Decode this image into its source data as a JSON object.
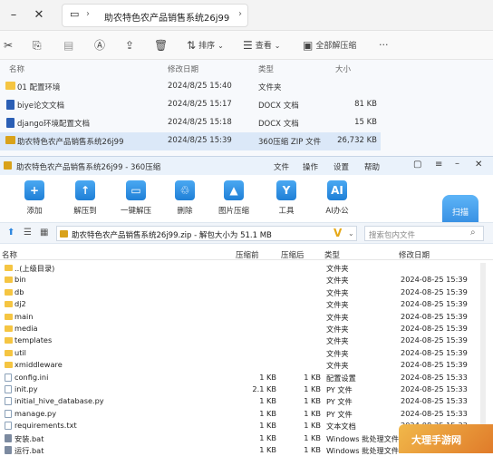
{
  "explorer": {
    "path": "助农特色农产品销售系统26j99",
    "toolbar": {
      "sort": "排序",
      "view": "查看",
      "extract_all": "全部解压缩",
      "more": "···"
    },
    "columns": {
      "name": "名称",
      "date": "修改日期",
      "type": "类型",
      "size": "大小"
    },
    "rows": [
      {
        "name": "01 配置环境",
        "date": "2024/8/25 15:40",
        "type": "文件夹",
        "size": "",
        "icon": "folder"
      },
      {
        "name": "biye论文文档",
        "date": "2024/8/25 15:17",
        "type": "DOCX 文档",
        "size": "81 KB",
        "icon": "docx"
      },
      {
        "name": "django环境配置文档",
        "date": "2024/8/25 15:18",
        "type": "DOCX 文档",
        "size": "15 KB",
        "icon": "docx"
      },
      {
        "name": "助农特色农产品销售系统26j99",
        "date": "2024/8/25 15:39",
        "type": "360压缩 ZIP 文件",
        "size": "26,732 KB",
        "icon": "zip"
      }
    ]
  },
  "zipwin": {
    "title": "助农特色农产品销售系统26j99 - 360压缩",
    "menu": [
      "文件",
      "操作",
      "设置",
      "帮助"
    ],
    "tools": [
      {
        "label": "添加",
        "glyph": "+"
      },
      {
        "label": "解压到",
        "glyph": "↑"
      },
      {
        "label": "一键解压",
        "glyph": "▭"
      },
      {
        "label": "删除",
        "glyph": "♲"
      },
      {
        "label": "图片压缩",
        "glyph": "▲"
      },
      {
        "label": "工具",
        "glyph": "Y"
      },
      {
        "label": "AI办公",
        "glyph": "AI"
      }
    ],
    "scan_label": "扫描",
    "path": "助农特色农产品销售系统26j99.zip - 解包大小为 51.1 MB",
    "search_placeholder": "搜索包内文件",
    "columns": {
      "name": "名称",
      "packed": "压缩前",
      "size": "压缩后",
      "type": "类型",
      "date": "修改日期"
    },
    "rows": [
      {
        "name": "..(上级目录)",
        "packed": "",
        "size": "",
        "type": "文件夹",
        "date": "",
        "icon": "folder"
      },
      {
        "name": "bin",
        "packed": "",
        "size": "",
        "type": "文件夹",
        "date": "2024-08-25 15:39",
        "icon": "folder"
      },
      {
        "name": "db",
        "packed": "",
        "size": "",
        "type": "文件夹",
        "date": "2024-08-25 15:39",
        "icon": "folder"
      },
      {
        "name": "dj2",
        "packed": "",
        "size": "",
        "type": "文件夹",
        "date": "2024-08-25 15:39",
        "icon": "folder"
      },
      {
        "name": "main",
        "packed": "",
        "size": "",
        "type": "文件夹",
        "date": "2024-08-25 15:39",
        "icon": "folder"
      },
      {
        "name": "media",
        "packed": "",
        "size": "",
        "type": "文件夹",
        "date": "2024-08-25 15:39",
        "icon": "folder"
      },
      {
        "name": "templates",
        "packed": "",
        "size": "",
        "type": "文件夹",
        "date": "2024-08-25 15:39",
        "icon": "folder"
      },
      {
        "name": "util",
        "packed": "",
        "size": "",
        "type": "文件夹",
        "date": "2024-08-25 15:39",
        "icon": "folder"
      },
      {
        "name": "xmiddleware",
        "packed": "",
        "size": "",
        "type": "文件夹",
        "date": "2024-08-25 15:39",
        "icon": "folder"
      },
      {
        "name": "config.ini",
        "packed": "1 KB",
        "size": "1 KB",
        "type": "配置设置",
        "date": "2024-08-25 15:33",
        "icon": "file"
      },
      {
        "name": "init.py",
        "packed": "2.1 KB",
        "size": "1 KB",
        "type": "PY 文件",
        "date": "2024-08-25 15:33",
        "icon": "file"
      },
      {
        "name": "initial_hive_database.py",
        "packed": "1 KB",
        "size": "1 KB",
        "type": "PY 文件",
        "date": "2024-08-25 15:33",
        "icon": "file"
      },
      {
        "name": "manage.py",
        "packed": "1 KB",
        "size": "1 KB",
        "type": "PY 文件",
        "date": "2024-08-25 15:33",
        "icon": "file"
      },
      {
        "name": "requirements.txt",
        "packed": "1 KB",
        "size": "1 KB",
        "type": "文本文档",
        "date": "2024-08-25 15:33",
        "icon": "file"
      },
      {
        "name": "安装.bat",
        "packed": "1 KB",
        "size": "1 KB",
        "type": "Windows 批处理文件",
        "date": "2024-08-25 15:33",
        "icon": "bat"
      },
      {
        "name": "运行.bat",
        "packed": "1 KB",
        "size": "1 KB",
        "type": "Windows 批处理文件",
        "date": "2024-08-25 15:33",
        "icon": "bat"
      }
    ]
  },
  "watermark": "大理手游网"
}
